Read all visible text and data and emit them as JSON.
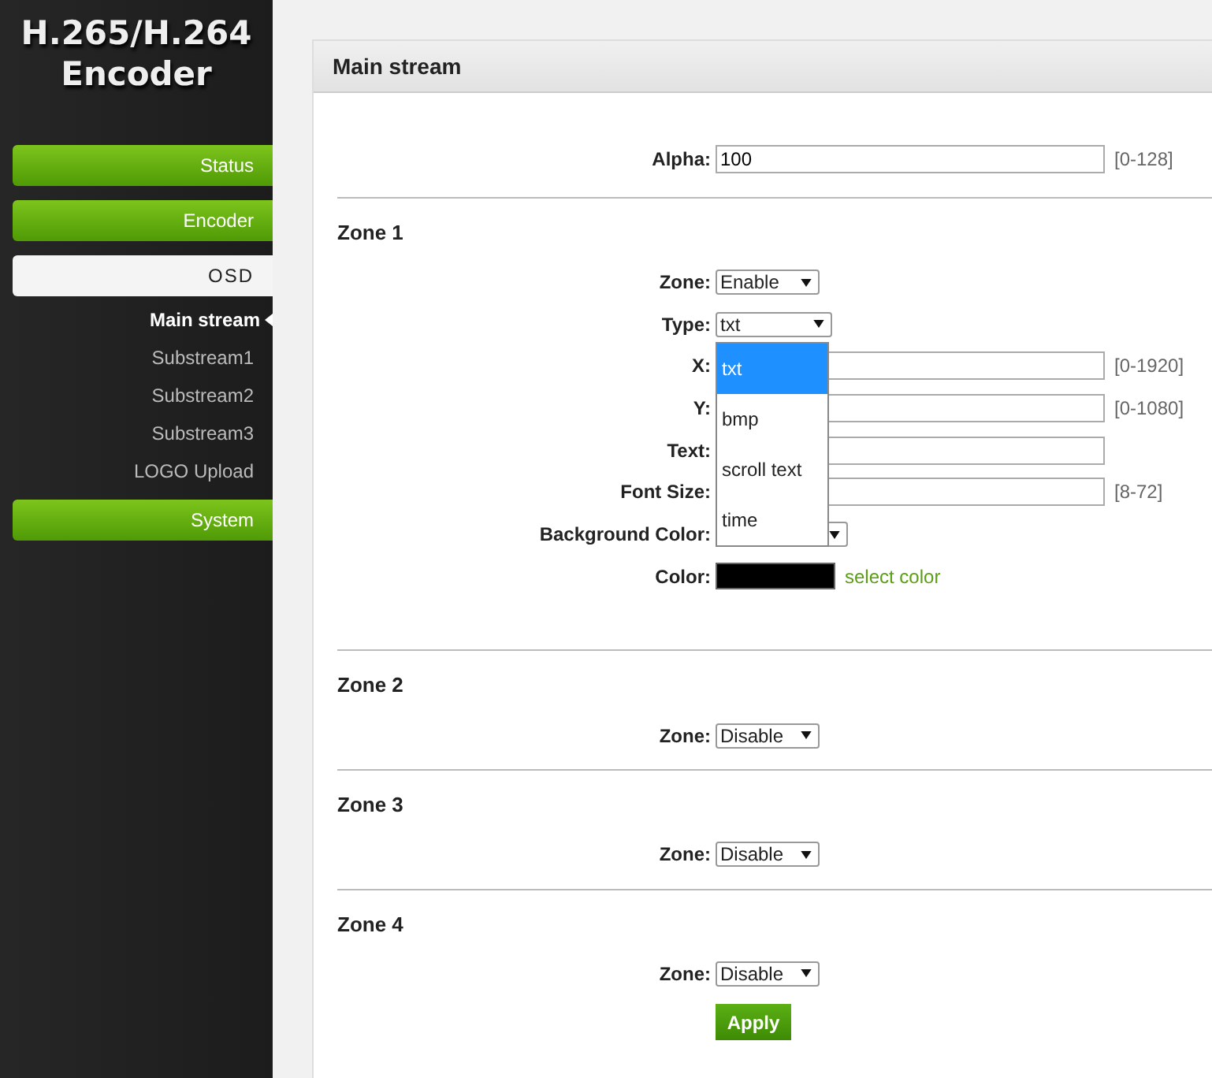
{
  "sidebar": {
    "logo": [
      "H.265/H.264",
      "Encoder"
    ],
    "items": [
      {
        "label": "Status",
        "kind": "main",
        "selected": false
      },
      {
        "label": "Encoder",
        "kind": "main",
        "selected": false
      },
      {
        "label": "OSD",
        "kind": "main",
        "selected": true
      },
      {
        "label": "Main stream",
        "kind": "sub",
        "selected": true
      },
      {
        "label": "Substream1",
        "kind": "sub",
        "selected": false
      },
      {
        "label": "Substream2",
        "kind": "sub",
        "selected": false
      },
      {
        "label": "Substream3",
        "kind": "sub",
        "selected": false
      },
      {
        "label": "LOGO Upload",
        "kind": "sub",
        "selected": false
      },
      {
        "label": "System",
        "kind": "main",
        "selected": false
      }
    ]
  },
  "panel": {
    "title": "Main stream",
    "alpha": {
      "label": "Alpha:",
      "value": "100",
      "range": "[0-128]"
    },
    "zones": [
      {
        "title": "Zone 1",
        "fields": [
          {
            "kind": "select",
            "label": "Zone:",
            "value": "Enable"
          },
          {
            "kind": "select",
            "label": "Type:",
            "value": "txt",
            "options": [
              {
                "label": "txt",
                "selected": true
              },
              {
                "label": "bmp",
                "selected": false
              },
              {
                "label": "scroll text",
                "selected": false
              },
              {
                "label": "time",
                "selected": false
              }
            ]
          },
          {
            "kind": "input",
            "label": "X:",
            "range": "[0-1920]"
          },
          {
            "kind": "input",
            "label": "Y:",
            "range": "[0-1080]"
          },
          {
            "kind": "input",
            "label": "Text:"
          },
          {
            "kind": "input",
            "label": "Font Size:",
            "range": "[8-72]"
          },
          {
            "kind": "select",
            "label": "Background Color:"
          },
          {
            "kind": "color",
            "label": "Color:",
            "color": "#000000",
            "link": "select color"
          }
        ]
      },
      {
        "title": "Zone 2",
        "fields": [
          {
            "kind": "select",
            "label": "Zone:",
            "value": "Disable"
          }
        ]
      },
      {
        "title": "Zone 3",
        "fields": [
          {
            "kind": "select",
            "label": "Zone:",
            "value": "Disable"
          }
        ]
      },
      {
        "title": "Zone 4",
        "fields": [
          {
            "kind": "select",
            "label": "Zone:",
            "value": "Disable"
          }
        ]
      }
    ],
    "button": "Apply"
  }
}
